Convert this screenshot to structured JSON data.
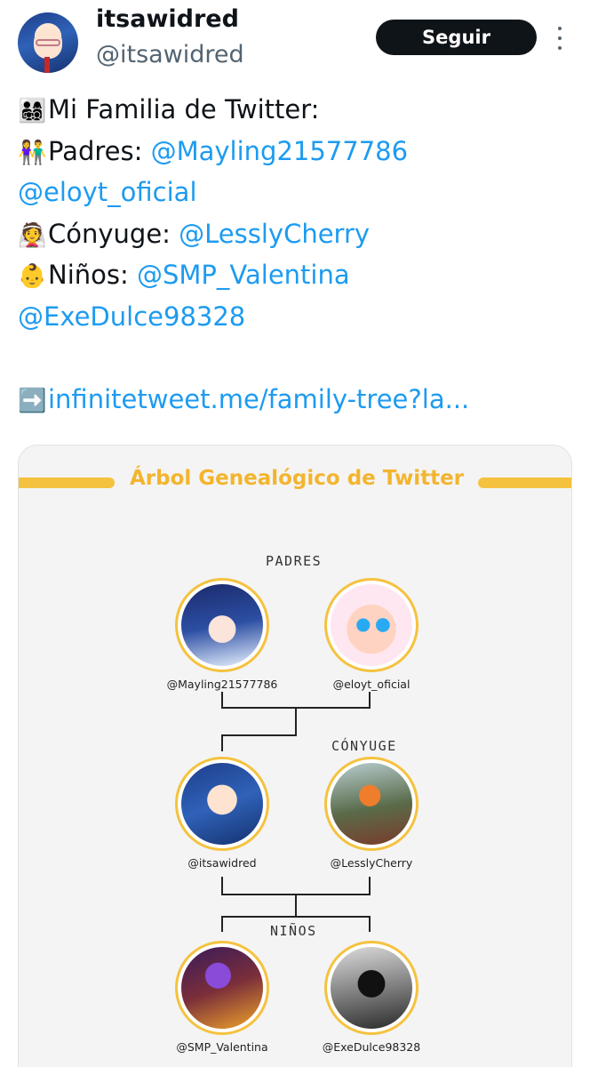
{
  "profile": {
    "display_name": "itsawidred",
    "handle": "@itsawidred",
    "follow_label": "Seguir"
  },
  "tweet": {
    "lines": [
      {
        "emoji": "👨‍👩‍👧‍👦",
        "text": "Mi Familia de Twitter:",
        "mention": ""
      },
      {
        "emoji": "👫",
        "text": "Padres: ",
        "mention": "@Mayling21577786"
      },
      {
        "emoji": "",
        "text": "",
        "mention": "@eloyt_oficial"
      },
      {
        "emoji": "👰",
        "text": "Cónyuge: ",
        "mention": "@LesslyCherry"
      },
      {
        "emoji": "👶",
        "text": "Niños: ",
        "mention": "@SMP_Valentina"
      },
      {
        "emoji": "",
        "text": "",
        "mention": "@ExeDulce98328"
      },
      {
        "emoji": "➡️",
        "text": "",
        "mention": "infinitetweet.me/family-tree?la..."
      }
    ]
  },
  "card": {
    "title": "Árbol Genealógico de Twitter",
    "sections": {
      "padres": "PADRES",
      "conyuge": "CÓNYUGE",
      "ninos": "NIÑOS"
    },
    "members": {
      "mayling": "@Mayling21577786",
      "eloyt": "@eloyt_oficial",
      "itsawidred": "@itsawidred",
      "lessly": "@LesslyCherry",
      "smp": "@SMP_Valentina",
      "exe": "@ExeDulce98328"
    }
  },
  "colors": {
    "accent_gold": "#f5c23f",
    "link_blue": "#1d9bf0",
    "follow_button": "#0f1419"
  }
}
